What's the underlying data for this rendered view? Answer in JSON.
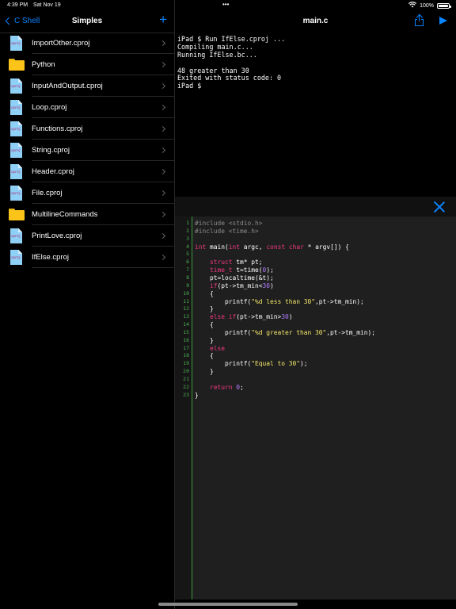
{
  "status_bar": {
    "time": "4:39 PM",
    "date": "Sat Nov 19",
    "dots": "•••",
    "battery": "100%",
    "battery_level": 1.0
  },
  "sidebar": {
    "back_label": "C Shell",
    "title": "Simples",
    "add_label": "+",
    "items": [
      {
        "name": "ImportOther.cproj",
        "type": "file"
      },
      {
        "name": "Python",
        "type": "folder"
      },
      {
        "name": "InputAndOutput.cproj",
        "type": "file"
      },
      {
        "name": "Loop.cproj",
        "type": "file"
      },
      {
        "name": "Functions.cproj",
        "type": "file"
      },
      {
        "name": "String.cproj",
        "type": "file"
      },
      {
        "name": "Header.cproj",
        "type": "file"
      },
      {
        "name": "File.cproj",
        "type": "file"
      },
      {
        "name": "MultilineCommands",
        "type": "folder"
      },
      {
        "name": "PrintLove.cproj",
        "type": "file"
      },
      {
        "name": "IfElse.cproj",
        "type": "file"
      }
    ],
    "file_icon_text": "cproj"
  },
  "main": {
    "title": "main.c",
    "share_icon": "share-icon",
    "run_icon": "play-icon",
    "close_icon": "close-icon"
  },
  "console": {
    "lines": [
      "iPad $ Run IfElse.cproj ...",
      "Compiling main.c...",
      "Running IfElse.bc...",
      "",
      "48 greater than 30",
      "Exited with status code: 0",
      "iPad $"
    ]
  },
  "editor": {
    "line_numbers": [
      "1",
      "2",
      "3",
      "4",
      "5",
      "6",
      "7",
      "8",
      "9",
      "10",
      "11",
      "12",
      "13",
      "14",
      "15",
      "16",
      "17",
      "18",
      "19",
      "20",
      "21",
      "22",
      "23"
    ],
    "code": [
      [
        [
          "pp",
          "#include <stdio.h>"
        ]
      ],
      [
        [
          "pp",
          "#include <time.h>"
        ]
      ],
      [],
      [
        [
          "kw",
          "int"
        ],
        [
          "t",
          " main("
        ],
        [
          "kw",
          "int"
        ],
        [
          "t",
          " argc, "
        ],
        [
          "kw",
          "const char"
        ],
        [
          "t",
          " * argv[]) {"
        ]
      ],
      [],
      [
        [
          "t",
          "    "
        ],
        [
          "kw",
          "struct"
        ],
        [
          "t",
          " tm* pt;"
        ]
      ],
      [
        [
          "t",
          "    "
        ],
        [
          "kw",
          "time_t"
        ],
        [
          "t",
          " t=time("
        ],
        [
          "num",
          "0"
        ],
        [
          "t",
          ");"
        ]
      ],
      [
        [
          "t",
          "    pt=localtime(&t);"
        ]
      ],
      [
        [
          "t",
          "    "
        ],
        [
          "kw",
          "if"
        ],
        [
          "t",
          "(pt->tm_min<"
        ],
        [
          "num",
          "30"
        ],
        [
          "t",
          ")"
        ]
      ],
      [
        [
          "t",
          "    {"
        ]
      ],
      [
        [
          "t",
          "        printf("
        ],
        [
          "str",
          "\"%d less than 30\""
        ],
        [
          "t",
          ",pt->tm_min);"
        ]
      ],
      [
        [
          "t",
          "    }"
        ]
      ],
      [
        [
          "t",
          "    "
        ],
        [
          "kw",
          "else if"
        ],
        [
          "t",
          "(pt->tm_min>"
        ],
        [
          "num",
          "30"
        ],
        [
          "t",
          ")"
        ]
      ],
      [
        [
          "t",
          "    {"
        ]
      ],
      [
        [
          "t",
          "        printf("
        ],
        [
          "str",
          "\"%d greater than 30\""
        ],
        [
          "t",
          ",pt->tm_min);"
        ]
      ],
      [
        [
          "t",
          "    }"
        ]
      ],
      [
        [
          "t",
          "    "
        ],
        [
          "kw",
          "else"
        ]
      ],
      [
        [
          "t",
          "    {"
        ]
      ],
      [
        [
          "t",
          "        printf("
        ],
        [
          "str",
          "\"Equal to 30\""
        ],
        [
          "t",
          ");"
        ]
      ],
      [
        [
          "t",
          "    }"
        ]
      ],
      [],
      [
        [
          "t",
          "    "
        ],
        [
          "kw",
          "return"
        ],
        [
          "t",
          " "
        ],
        [
          "num",
          "0"
        ],
        [
          "t",
          ";"
        ]
      ],
      [
        [
          "t",
          "}"
        ]
      ]
    ]
  }
}
